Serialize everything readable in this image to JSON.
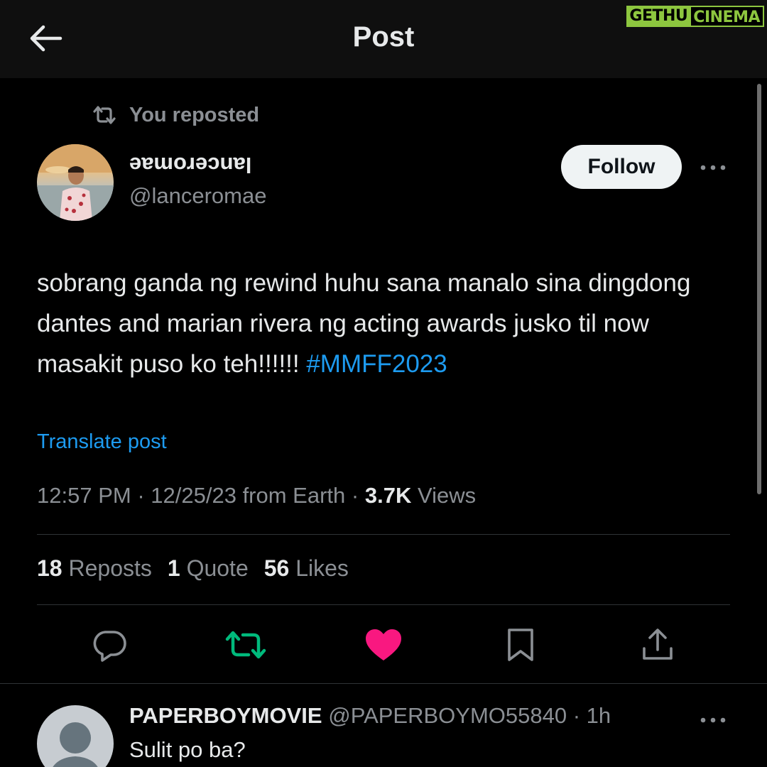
{
  "header": {
    "title": "Post",
    "watermark": [
      "GETHU",
      "CINEMA"
    ]
  },
  "post": {
    "repost_context": "You reposted",
    "author": {
      "display_name": "lanceromae",
      "handle": "@lanceromae"
    },
    "follow_label": "Follow",
    "text": "sobrang ganda ng rewind huhu sana manalo sina dingdong dantes and marian rivera ng acting awards jusko til now masakit puso ko teh!!!!!! ",
    "hashtag": "#MMFF2023",
    "translate_label": "Translate post",
    "meta": {
      "time": "12:57 PM",
      "date": "12/25/23",
      "source": "from Earth",
      "views_count": "3.7K",
      "views_label": "Views"
    },
    "stats": [
      {
        "count": "18",
        "label": "Reposts"
      },
      {
        "count": "1",
        "label": "Quote"
      },
      {
        "count": "56",
        "label": "Likes"
      }
    ]
  },
  "colors": {
    "background": "#000000",
    "header_bg": "#0f0f0f",
    "text": "#e7e9ea",
    "muted": "#8b8f94",
    "link": "#1d9bf0",
    "repost_active": "#00ba7c",
    "like_active": "#f91880",
    "divider": "#2f3336",
    "watermark": "#8dc63f"
  },
  "icons": {
    "back": "arrow-left-icon",
    "repost_context": "repost-icon",
    "more": "more-horizontal-icon",
    "reply": "reply-icon",
    "repost": "repost-icon",
    "like": "heart-icon",
    "bookmark": "bookmark-icon",
    "share": "share-icon"
  },
  "reply": {
    "name": "PAPERBOYMOVIE",
    "handle": "@PAPERBOYMO55840",
    "time": "1h",
    "text": "Sulit po ba?"
  }
}
